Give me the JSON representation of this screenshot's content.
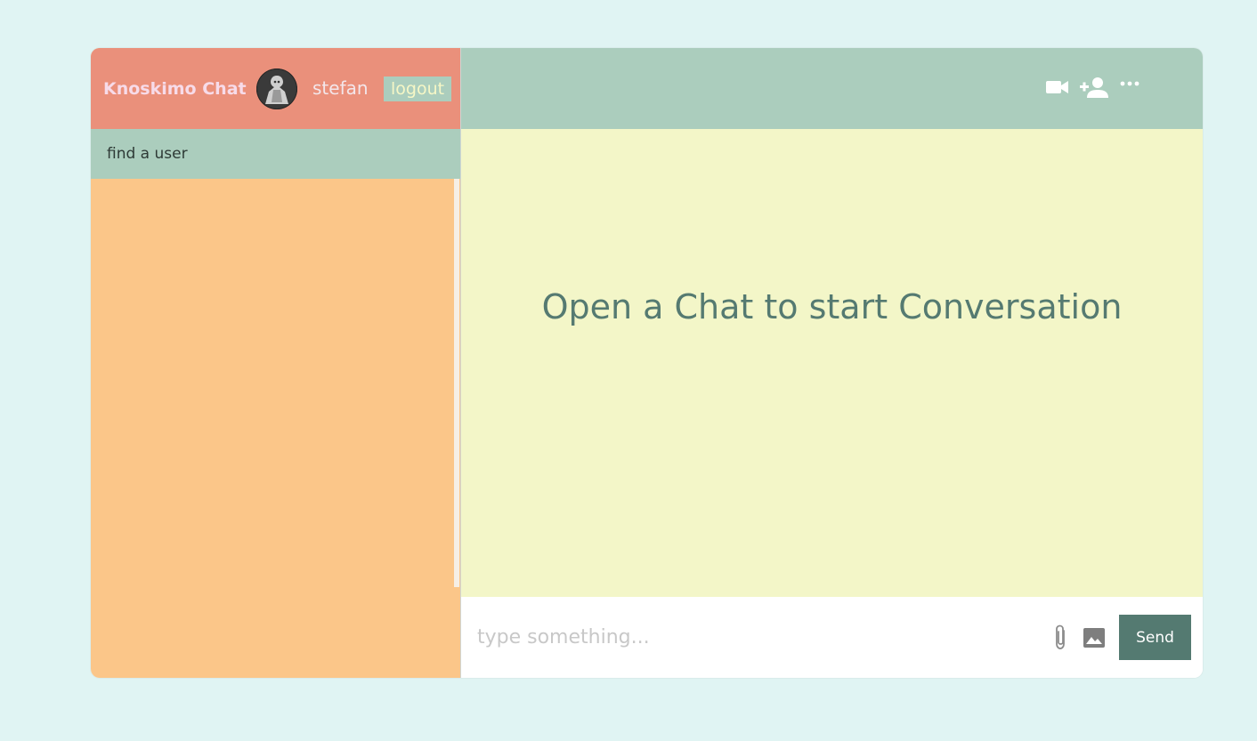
{
  "navbar": {
    "logo": "Knoskimo Chat",
    "username": "stefan",
    "logout_label": "logout"
  },
  "search": {
    "placeholder": "find a user"
  },
  "chat": {
    "empty_message": "Open a Chat to start Conversation",
    "icons": [
      "video-camera-icon",
      "add-user-icon",
      "more-options-icon"
    ]
  },
  "input": {
    "placeholder": "type something...",
    "send_label": "Send",
    "icons": [
      "paperclip-icon",
      "image-icon"
    ]
  },
  "colors": {
    "page_bg": "#e0f4f3",
    "navbar": "#ea907b",
    "search_bar": "#abcdbd",
    "sidebar": "#fbc689",
    "chat_header": "#abcdbd",
    "messages_bg": "#f3f6c8",
    "send_button": "#547a71",
    "empty_text": "#557a71"
  }
}
